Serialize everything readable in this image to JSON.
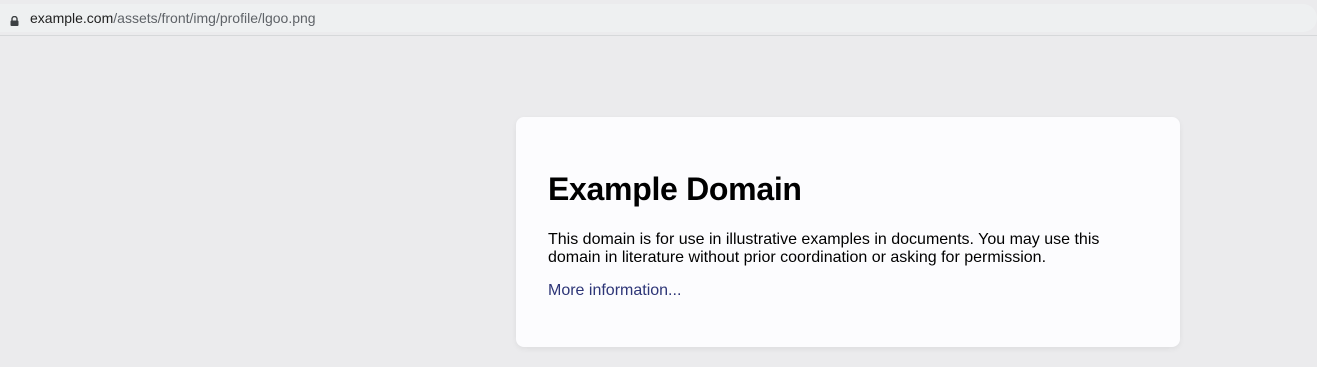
{
  "browser": {
    "address_bar": {
      "host": "example.com",
      "path": "/assets/front/img/profile/lgoo.png",
      "lock_icon": "lock-icon"
    }
  },
  "page": {
    "heading": "Example Domain",
    "description": "This domain is for use in illustrative examples in documents. You may use this domain in literature without prior coordination or asking for permission.",
    "link_text": "More information..."
  },
  "colors": {
    "page_background": "#ebebed",
    "card_background": "#fcfcfe",
    "link": "#2d3577"
  }
}
